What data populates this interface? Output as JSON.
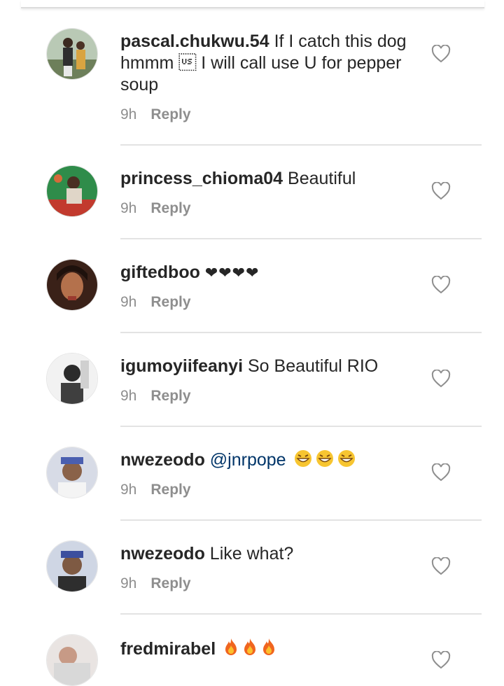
{
  "comments": [
    {
      "username": "pascal.chukwu.54",
      "text": "If I catch this dog hmmm \u001f I will call use U for pepper soup",
      "time": "9h",
      "reply": "Reply"
    },
    {
      "username": "princess_chioma04",
      "text": "Beautiful",
      "time": "9h",
      "reply": "Reply"
    },
    {
      "username": "giftedboo",
      "text": "❤❤❤❤",
      "time": "9h",
      "reply": "Reply"
    },
    {
      "username": "igumoyiifeanyi",
      "text": "So Beautiful RIO",
      "time": "9h",
      "reply": "Reply"
    },
    {
      "username": "nwezeodo",
      "mention": "@jnrpope",
      "time": "9h",
      "reply": "Reply"
    },
    {
      "username": "nwezeodo",
      "text": "Like what?",
      "time": "9h",
      "reply": "Reply"
    },
    {
      "username": "fredmirabel"
    }
  ],
  "icons": {
    "like": "heart-outline-icon",
    "laugh": "laughing-face-emoji",
    "fire": "fire-emoji",
    "black_heart": "black-heart-emoji"
  }
}
